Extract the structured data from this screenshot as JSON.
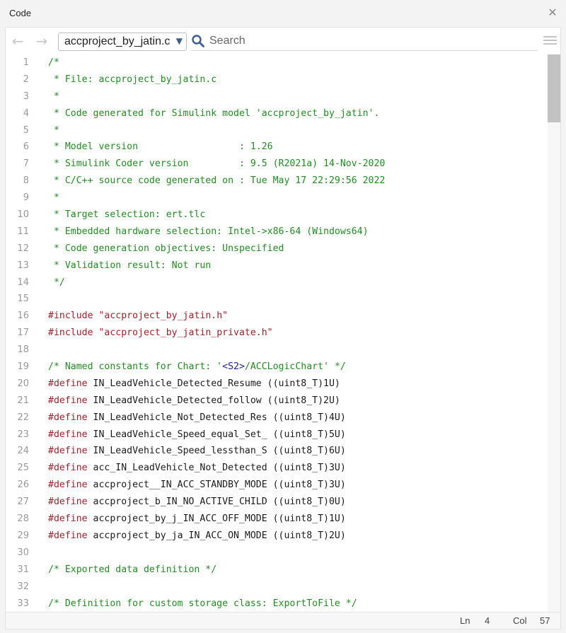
{
  "window": {
    "title": "Code"
  },
  "toolbar": {
    "file_name": "accproject_by_jatin.c",
    "search_placeholder": "Search"
  },
  "code": {
    "lines": [
      {
        "n": "1",
        "tokens": [
          {
            "t": "/*",
            "c": "comment"
          }
        ]
      },
      {
        "n": "2",
        "tokens": [
          {
            "t": " * File: accproject_by_jatin.c",
            "c": "comment"
          }
        ]
      },
      {
        "n": "3",
        "tokens": [
          {
            "t": " *",
            "c": "comment"
          }
        ]
      },
      {
        "n": "4",
        "tokens": [
          {
            "t": " * Code generated for Simulink model 'accproject_by_jatin'.",
            "c": "comment"
          }
        ]
      },
      {
        "n": "5",
        "tokens": [
          {
            "t": " *",
            "c": "comment"
          }
        ]
      },
      {
        "n": "6",
        "tokens": [
          {
            "t": " * Model version                  : 1.26",
            "c": "comment"
          }
        ]
      },
      {
        "n": "7",
        "tokens": [
          {
            "t": " * Simulink Coder version         : 9.5 (R2021a) 14-Nov-2020",
            "c": "comment"
          }
        ]
      },
      {
        "n": "8",
        "tokens": [
          {
            "t": " * C/C++ source code generated on : Tue May 17 22:29:56 2022",
            "c": "comment"
          }
        ]
      },
      {
        "n": "9",
        "tokens": [
          {
            "t": " *",
            "c": "comment"
          }
        ]
      },
      {
        "n": "10",
        "tokens": [
          {
            "t": " * Target selection: ert.tlc",
            "c": "comment"
          }
        ]
      },
      {
        "n": "11",
        "tokens": [
          {
            "t": " * Embedded hardware selection: Intel->x86-64 (Windows64)",
            "c": "comment"
          }
        ]
      },
      {
        "n": "12",
        "tokens": [
          {
            "t": " * Code generation objectives: Unspecified",
            "c": "comment"
          }
        ]
      },
      {
        "n": "13",
        "tokens": [
          {
            "t": " * Validation result: Not run",
            "c": "comment"
          }
        ]
      },
      {
        "n": "14",
        "tokens": [
          {
            "t": " */",
            "c": "comment"
          }
        ]
      },
      {
        "n": "15",
        "tokens": []
      },
      {
        "n": "16",
        "tokens": [
          {
            "t": "#include ",
            "c": "pp"
          },
          {
            "t": "\"accproject_by_jatin.h\"",
            "c": "str"
          }
        ]
      },
      {
        "n": "17",
        "tokens": [
          {
            "t": "#include ",
            "c": "pp"
          },
          {
            "t": "\"accproject_by_jatin_private.h\"",
            "c": "str"
          }
        ]
      },
      {
        "n": "18",
        "tokens": []
      },
      {
        "n": "19",
        "tokens": [
          {
            "t": "/* Named constants for Chart: '",
            "c": "comment"
          },
          {
            "t": "<S2>",
            "c": "link"
          },
          {
            "t": "/ACCLogicChart' */",
            "c": "comment"
          }
        ]
      },
      {
        "n": "20",
        "tokens": [
          {
            "t": "#define ",
            "c": "pp"
          },
          {
            "t": "IN_LeadVehicle_Detected_Resume ((uint8_T)1U)",
            "c": "plain"
          }
        ]
      },
      {
        "n": "21",
        "tokens": [
          {
            "t": "#define ",
            "c": "pp"
          },
          {
            "t": "IN_LeadVehicle_Detected_follow ((uint8_T)2U)",
            "c": "plain"
          }
        ]
      },
      {
        "n": "22",
        "tokens": [
          {
            "t": "#define ",
            "c": "pp"
          },
          {
            "t": "IN_LeadVehicle_Not_Detected_Res ((uint8_T)4U)",
            "c": "plain"
          }
        ]
      },
      {
        "n": "23",
        "tokens": [
          {
            "t": "#define ",
            "c": "pp"
          },
          {
            "t": "IN_LeadVehicle_Speed_equal_Set_ ((uint8_T)5U)",
            "c": "plain"
          }
        ]
      },
      {
        "n": "24",
        "tokens": [
          {
            "t": "#define ",
            "c": "pp"
          },
          {
            "t": "IN_LeadVehicle_Speed_lessthan_S ((uint8_T)6U)",
            "c": "plain"
          }
        ]
      },
      {
        "n": "25",
        "tokens": [
          {
            "t": "#define ",
            "c": "pp"
          },
          {
            "t": "acc_IN_LeadVehicle_Not_Detected ((uint8_T)3U)",
            "c": "plain"
          }
        ]
      },
      {
        "n": "26",
        "tokens": [
          {
            "t": "#define ",
            "c": "pp"
          },
          {
            "t": "accproject__IN_ACC_STANDBY_MODE ((uint8_T)3U)",
            "c": "plain"
          }
        ]
      },
      {
        "n": "27",
        "tokens": [
          {
            "t": "#define ",
            "c": "pp"
          },
          {
            "t": "accproject_b_IN_NO_ACTIVE_CHILD ((uint8_T)0U)",
            "c": "plain"
          }
        ]
      },
      {
        "n": "28",
        "tokens": [
          {
            "t": "#define ",
            "c": "pp"
          },
          {
            "t": "accproject_by_j_IN_ACC_OFF_MODE ((uint8_T)1U)",
            "c": "plain"
          }
        ]
      },
      {
        "n": "29",
        "tokens": [
          {
            "t": "#define ",
            "c": "pp"
          },
          {
            "t": "accproject_by_ja_IN_ACC_ON_MODE ((uint8_T)2U)",
            "c": "plain"
          }
        ]
      },
      {
        "n": "30",
        "tokens": []
      },
      {
        "n": "31",
        "tokens": [
          {
            "t": "/* Exported data definition */",
            "c": "comment"
          }
        ]
      },
      {
        "n": "32",
        "tokens": []
      },
      {
        "n": "33",
        "tokens": [
          {
            "t": "/* Definition for custom storage class: ExportToFile */",
            "c": "comment"
          }
        ]
      }
    ]
  },
  "status": {
    "ln_label": "Ln",
    "ln_value": "4",
    "col_label": "Col",
    "col_value": "57"
  },
  "colors": {
    "comment": "#228b22",
    "preprocessor": "#a0202a",
    "scroll_thumb": "#c2c2c2"
  },
  "icons": [
    "close-icon",
    "back-arrow-icon",
    "forward-arrow-icon",
    "chevron-down-icon",
    "search-icon",
    "hamburger-menu-icon"
  ]
}
